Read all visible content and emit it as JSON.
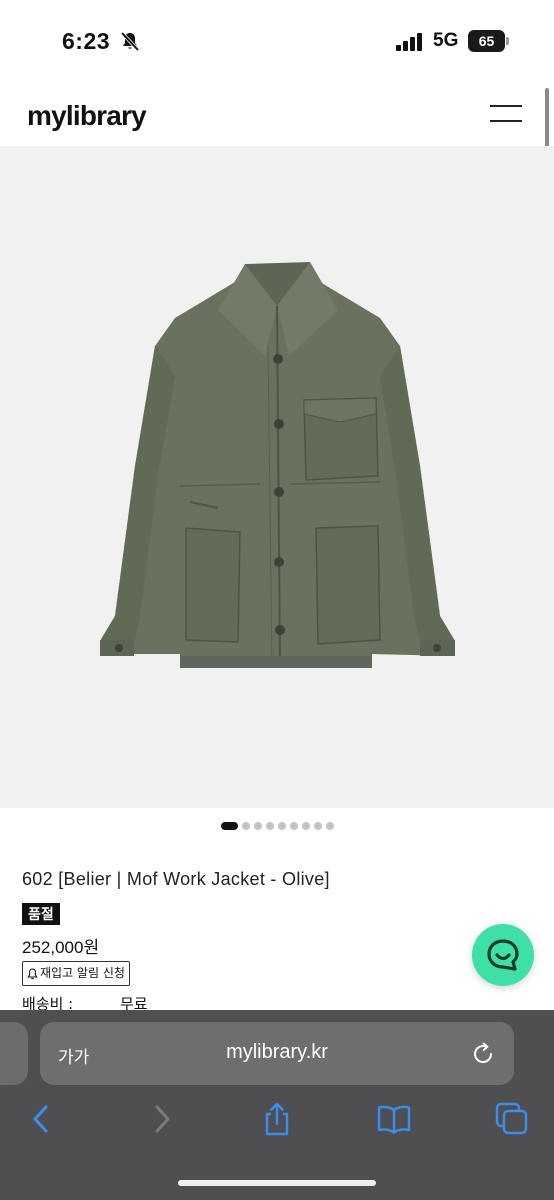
{
  "status_bar": {
    "time": "6:23",
    "network": "5G",
    "battery": "65"
  },
  "site": {
    "logo": "mylibrary",
    "menu_icon": "hamburger-menu-icon"
  },
  "carousel": {
    "total_images": 9,
    "active_index": 0
  },
  "product": {
    "name": "602 [Belier | Mof Work Jacket - Olive]",
    "badge": "품절",
    "price": "252,000원",
    "restock_button": "재입고 알림 신청",
    "shipping_label": "배송비 :",
    "shipping_value": "무료"
  },
  "chat": {
    "icon": "chat-bubble-icon",
    "color": "#3EE0A8"
  },
  "browser": {
    "text_size_label": "가가",
    "url": "mylibrary.kr",
    "toolbar": [
      "back-icon",
      "forward-icon",
      "share-icon",
      "bookmarks-icon",
      "tabs-icon"
    ],
    "accent_color": "#3B8EF0"
  },
  "colors": {
    "jacket_olive": "#6A715E",
    "image_background": "#F1F1F1"
  }
}
